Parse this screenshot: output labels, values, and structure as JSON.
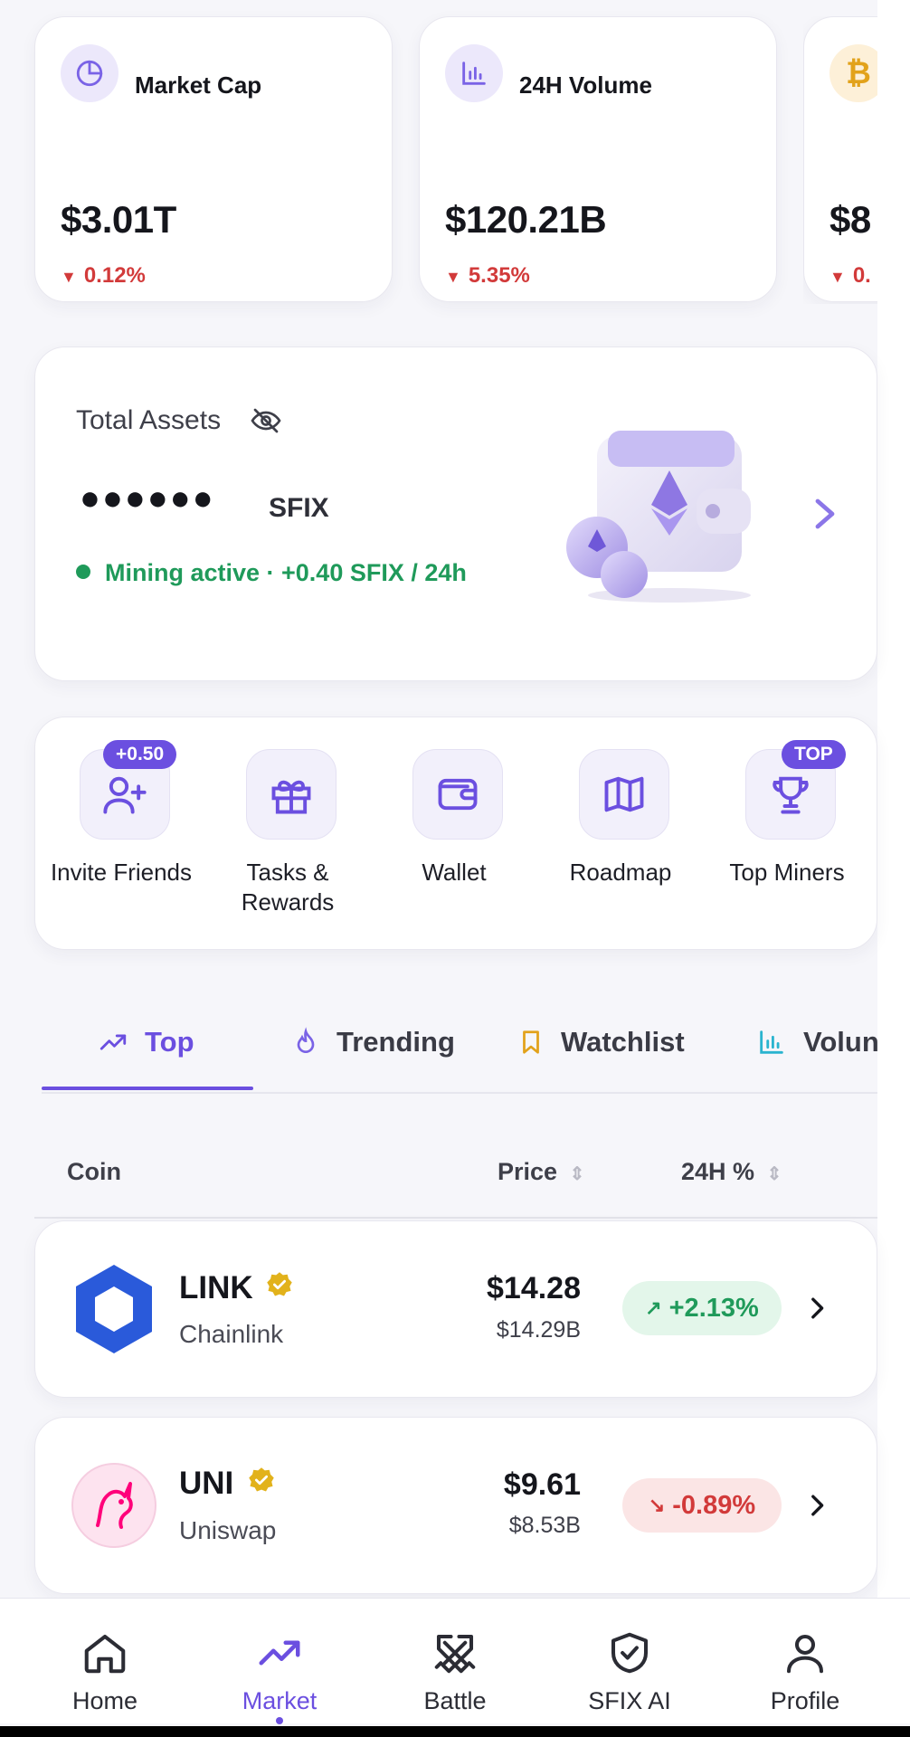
{
  "stats": [
    {
      "label": "Market Cap",
      "value": "$3.01T",
      "change": "0.12%",
      "icon": "pie-chart-icon"
    },
    {
      "label": "24H Volume",
      "value": "$120.21B",
      "change": "5.35%",
      "icon": "bar-chart-icon"
    },
    {
      "label": "",
      "value": "$8",
      "change": "0.",
      "icon": "bitcoin-icon"
    }
  ],
  "assets": {
    "title": "Total Assets",
    "masked_balance": "●●●●●●",
    "unit": "SFIX",
    "mining_status": "Mining active · +0.40 SFIX / 24h"
  },
  "actions": [
    {
      "label": "Invite Friends",
      "badge": "+0.50",
      "icon": "add-user-icon"
    },
    {
      "label": "Tasks & Rewards",
      "icon": "gift-icon"
    },
    {
      "label": "Wallet",
      "icon": "wallet-icon"
    },
    {
      "label": "Roadmap",
      "icon": "map-icon"
    },
    {
      "label": "Top Miners",
      "badge": "TOP",
      "icon": "trophy-icon"
    }
  ],
  "tabs": [
    {
      "label": "Top",
      "icon": "trending-up-icon",
      "active": true
    },
    {
      "label": "Trending",
      "icon": "flame-icon"
    },
    {
      "label": "Watchlist",
      "icon": "bookmark-icon"
    },
    {
      "label": "Volun",
      "icon": "bar-chart-icon"
    }
  ],
  "table": {
    "col_coin": "Coin",
    "col_price": "Price",
    "col_change": "24H %"
  },
  "coins": [
    {
      "symbol": "LINK",
      "name": "Chainlink",
      "price": "$14.28",
      "market_cap": "$14.29B",
      "change": "+2.13%",
      "direction": "up",
      "verified": true
    },
    {
      "symbol": "UNI",
      "name": "Uniswap",
      "price": "$9.61",
      "market_cap": "$8.53B",
      "change": "-0.89%",
      "direction": "down",
      "verified": true
    }
  ],
  "nav": [
    {
      "label": "Home",
      "icon": "home-icon"
    },
    {
      "label": "Market",
      "icon": "trending-up-icon",
      "active": true
    },
    {
      "label": "Battle",
      "icon": "crossed-swords-icon"
    },
    {
      "label": "SFIX AI",
      "icon": "shield-check-icon"
    },
    {
      "label": "Profile",
      "icon": "user-icon"
    }
  ],
  "colors": {
    "accent": "#6b4fe0",
    "up": "#1f9a5a",
    "down": "#d23a3a",
    "verified": "#e2b21b"
  }
}
